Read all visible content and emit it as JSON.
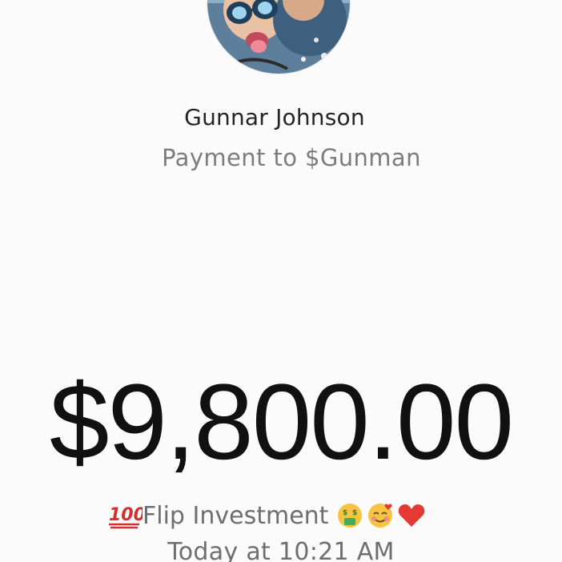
{
  "recipient": {
    "name": "Gunnar Johnson",
    "subtitle": "Payment to $Gunman",
    "avatar_icon": "profile-photo"
  },
  "payment": {
    "amount": "$9,800.00",
    "note_prefix_icon": "hundred-points-emoji",
    "note_text": "Flip Investment",
    "note_suffix_icons": [
      "money-mouth-face-emoji",
      "smiling-face-with-hearts-emoji",
      "red-heart-emoji"
    ],
    "timestamp": "Today at 10:21 AM"
  },
  "colors": {
    "background": "#fbfbfb",
    "amount": "#111111",
    "muted_text": "#7c7c7c"
  }
}
